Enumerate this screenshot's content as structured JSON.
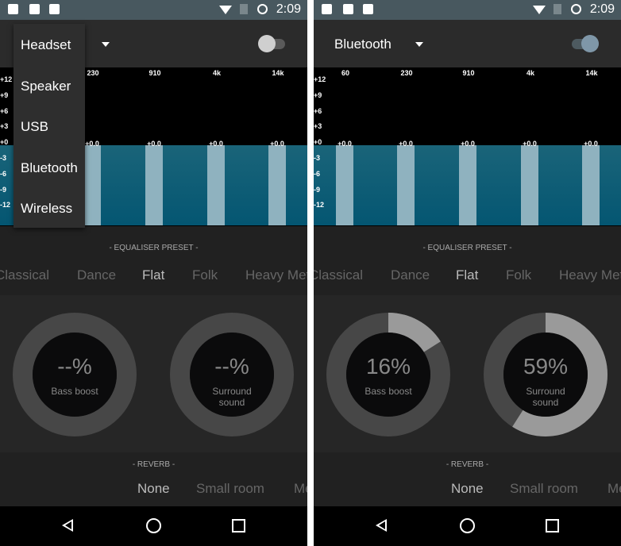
{
  "status_bar": {
    "time": "2:09",
    "left_icons": [
      "image-icon",
      "clipboard-check-icon",
      "play-store-icon"
    ],
    "right_icons": [
      "wifi-icon",
      "no-sim-icon",
      "sync-icon"
    ]
  },
  "colors": {
    "status_bar": "#48585f",
    "eq_fill": "#0a5c76",
    "band_bar": "#8fb2bf",
    "toggle_on": "#7f97a8"
  },
  "panels": [
    {
      "output_selected": "Headset",
      "toggle_on": false,
      "dropdown_open": true,
      "dropdown_options": [
        "Headset",
        "Speaker",
        "USB",
        "Bluetooth",
        "Wireless"
      ],
      "bass_boost": {
        "value": "--%",
        "label": "Bass boost",
        "level": null
      },
      "surround": {
        "value": "--%",
        "label": "Surround sound",
        "level": null
      }
    },
    {
      "output_selected": "Bluetooth",
      "toggle_on": true,
      "dropdown_open": false,
      "bass_boost": {
        "value": "16%",
        "label": "Bass boost",
        "level": 16
      },
      "surround": {
        "value": "59%",
        "label": "Surround sound",
        "level": 59
      }
    }
  ],
  "equaliser": {
    "bands": [
      "60",
      "230",
      "910",
      "4k",
      "14k"
    ],
    "band_values": [
      "+0.0",
      "+0.0",
      "+0.0",
      "+0.0",
      "+0.0"
    ],
    "y_ticks": [
      "+12",
      "+9",
      "+6",
      "+3",
      "+0",
      "-3",
      "-6",
      "-9",
      "-12"
    ]
  },
  "preset": {
    "label": "- EQUALISER PRESET -",
    "items": [
      "Classical",
      "Dance",
      "Flat",
      "Folk",
      "Heavy Met"
    ],
    "selected": "Flat"
  },
  "reverb": {
    "label": "- REVERB -",
    "items": [
      "None",
      "Small room",
      "Me"
    ],
    "selected": "None"
  },
  "nav": {
    "icons": [
      "back-icon",
      "home-icon",
      "recents-icon"
    ]
  }
}
